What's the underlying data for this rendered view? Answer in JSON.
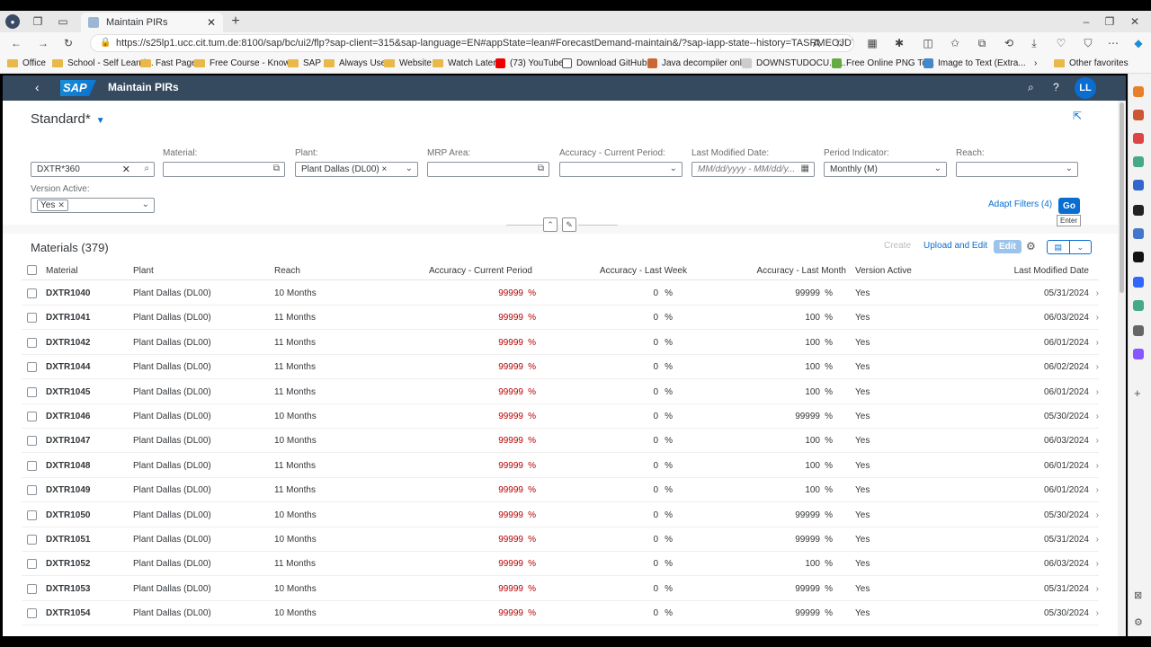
{
  "browser": {
    "tab_title": "Maintain PIRs",
    "tab_close": "✕",
    "new_tab": "+",
    "url": "https://s25lp1.ucc.cit.tum.de:8100/sap/bc/ui2/flp?sap-client=315&sap-language=EN#appState=lean#ForecastDemand-maintain&/?sap-iapp-state--history=TASRMEOJDYE9WZGN40I5...",
    "bookmarks": [
      "Office",
      "School - Self Learni...",
      "Fast Page",
      "Free Course - Know...",
      "SAP",
      "Always Use",
      "Website",
      "Watch Later",
      "(73) YouTube",
      "Download GitHub...",
      "Java decompiler onl...",
      "DOWNSTUDOCU.C...",
      "Free Online PNG To...",
      "Image to Text (Extra..."
    ],
    "other_favorites": "Other favorites"
  },
  "shell": {
    "app_title": "Maintain PIRs",
    "logo_text": "SAP",
    "avatar_initials": "LL"
  },
  "header": {
    "variant": "Standard*",
    "filters": {
      "search_value": "DXTR*360",
      "material_label": "Material:",
      "plant_label": "Plant:",
      "plant_value": "Plant Dallas (DL00) ×",
      "mrp_label": "MRP Area:",
      "accuracy_label": "Accuracy - Current Period:",
      "lastmod_label": "Last Modified Date:",
      "lastmod_placeholder": "MM/dd/yyyy - MM/dd/y...",
      "period_label": "Period Indicator:",
      "period_value": "Monthly (M)",
      "reach_label": "Reach:",
      "version_label": "Version Active:",
      "version_token": "Yes"
    },
    "adapt_filters": "Adapt Filters (4)",
    "go": "Go",
    "go_tooltip": "Enter"
  },
  "table": {
    "title": "Materials (379)",
    "create": "Create",
    "upload_edit": "Upload and Edit",
    "edit": "Edit",
    "columns": [
      "Material",
      "Plant",
      "Reach",
      "Accuracy - Current Period",
      "Accuracy - Last Week",
      "Accuracy - Last Month",
      "Version Active",
      "Last Modified Date"
    ],
    "rows": [
      {
        "material": "DXTR1040",
        "plant": "Plant Dallas (DL00)",
        "reach": "10 Months",
        "acc_cur": "99999",
        "acc_week": "0",
        "acc_month": "99999",
        "version": "Yes",
        "date": "05/31/2024"
      },
      {
        "material": "DXTR1041",
        "plant": "Plant Dallas (DL00)",
        "reach": "11 Months",
        "acc_cur": "99999",
        "acc_week": "0",
        "acc_month": "100",
        "version": "Yes",
        "date": "06/03/2024"
      },
      {
        "material": "DXTR1042",
        "plant": "Plant Dallas (DL00)",
        "reach": "11 Months",
        "acc_cur": "99999",
        "acc_week": "0",
        "acc_month": "100",
        "version": "Yes",
        "date": "06/01/2024"
      },
      {
        "material": "DXTR1044",
        "plant": "Plant Dallas (DL00)",
        "reach": "11 Months",
        "acc_cur": "99999",
        "acc_week": "0",
        "acc_month": "100",
        "version": "Yes",
        "date": "06/02/2024"
      },
      {
        "material": "DXTR1045",
        "plant": "Plant Dallas (DL00)",
        "reach": "11 Months",
        "acc_cur": "99999",
        "acc_week": "0",
        "acc_month": "100",
        "version": "Yes",
        "date": "06/01/2024"
      },
      {
        "material": "DXTR1046",
        "plant": "Plant Dallas (DL00)",
        "reach": "10 Months",
        "acc_cur": "99999",
        "acc_week": "0",
        "acc_month": "99999",
        "version": "Yes",
        "date": "05/30/2024"
      },
      {
        "material": "DXTR1047",
        "plant": "Plant Dallas (DL00)",
        "reach": "10 Months",
        "acc_cur": "99999",
        "acc_week": "0",
        "acc_month": "100",
        "version": "Yes",
        "date": "06/03/2024"
      },
      {
        "material": "DXTR1048",
        "plant": "Plant Dallas (DL00)",
        "reach": "11 Months",
        "acc_cur": "99999",
        "acc_week": "0",
        "acc_month": "100",
        "version": "Yes",
        "date": "06/01/2024"
      },
      {
        "material": "DXTR1049",
        "plant": "Plant Dallas (DL00)",
        "reach": "11 Months",
        "acc_cur": "99999",
        "acc_week": "0",
        "acc_month": "100",
        "version": "Yes",
        "date": "06/01/2024"
      },
      {
        "material": "DXTR1050",
        "plant": "Plant Dallas (DL00)",
        "reach": "10 Months",
        "acc_cur": "99999",
        "acc_week": "0",
        "acc_month": "99999",
        "version": "Yes",
        "date": "05/30/2024"
      },
      {
        "material": "DXTR1051",
        "plant": "Plant Dallas (DL00)",
        "reach": "10 Months",
        "acc_cur": "99999",
        "acc_week": "0",
        "acc_month": "99999",
        "version": "Yes",
        "date": "05/31/2024"
      },
      {
        "material": "DXTR1052",
        "plant": "Plant Dallas (DL00)",
        "reach": "11 Months",
        "acc_cur": "99999",
        "acc_week": "0",
        "acc_month": "100",
        "version": "Yes",
        "date": "06/03/2024"
      },
      {
        "material": "DXTR1053",
        "plant": "Plant Dallas (DL00)",
        "reach": "10 Months",
        "acc_cur": "99999",
        "acc_week": "0",
        "acc_month": "99999",
        "version": "Yes",
        "date": "05/31/2024"
      },
      {
        "material": "DXTR1054",
        "plant": "Plant Dallas (DL00)",
        "reach": "10 Months",
        "acc_cur": "99999",
        "acc_week": "0",
        "acc_month": "99999",
        "version": "Yes",
        "date": "05/30/2024"
      }
    ],
    "percent": "%"
  },
  "colors": {
    "shell_bg": "#354a5f",
    "accent": "#0a6ed1",
    "negative": "#bb0000"
  }
}
